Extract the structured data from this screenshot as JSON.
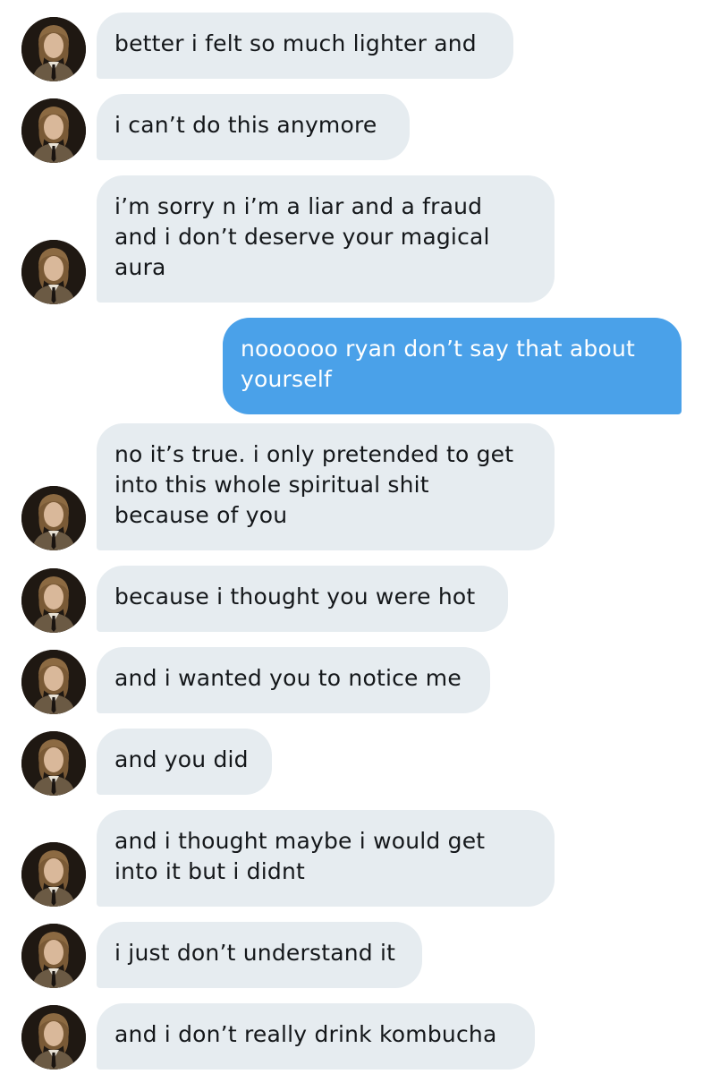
{
  "theme": {
    "incoming_bubble": "#e6ecf0",
    "outgoing_bubble": "#4aa1e9",
    "incoming_text": "#14171a",
    "outgoing_text": "#ffffff"
  },
  "avatar": {
    "icon": "user-avatar-photo"
  },
  "messages": [
    {
      "from": "other",
      "lines": [
        "better i felt so much lighter and"
      ]
    },
    {
      "from": "other",
      "lines": [
        "i can’t do this anymore"
      ]
    },
    {
      "from": "other",
      "lines": [
        "i’m sorry n i’m a liar and a fraud",
        "and i don’t deserve your magical",
        "aura"
      ]
    },
    {
      "from": "me",
      "lines": [
        "noooooo ryan don’t say that about",
        "yourself"
      ]
    },
    {
      "from": "other",
      "lines": [
        "no it’s true. i only pretended to get",
        "into this whole spiritual shit",
        "because of you"
      ]
    },
    {
      "from": "other",
      "lines": [
        "because i thought you were hot"
      ]
    },
    {
      "from": "other",
      "lines": [
        "and i wanted you to notice me"
      ]
    },
    {
      "from": "other",
      "lines": [
        "and you did"
      ]
    },
    {
      "from": "other",
      "lines": [
        "and i thought maybe i would get",
        "into it but i didnt"
      ]
    },
    {
      "from": "other",
      "lines": [
        "i just don’t understand it"
      ]
    },
    {
      "from": "other",
      "lines": [
        "and i don’t really drink kombucha"
      ]
    }
  ]
}
